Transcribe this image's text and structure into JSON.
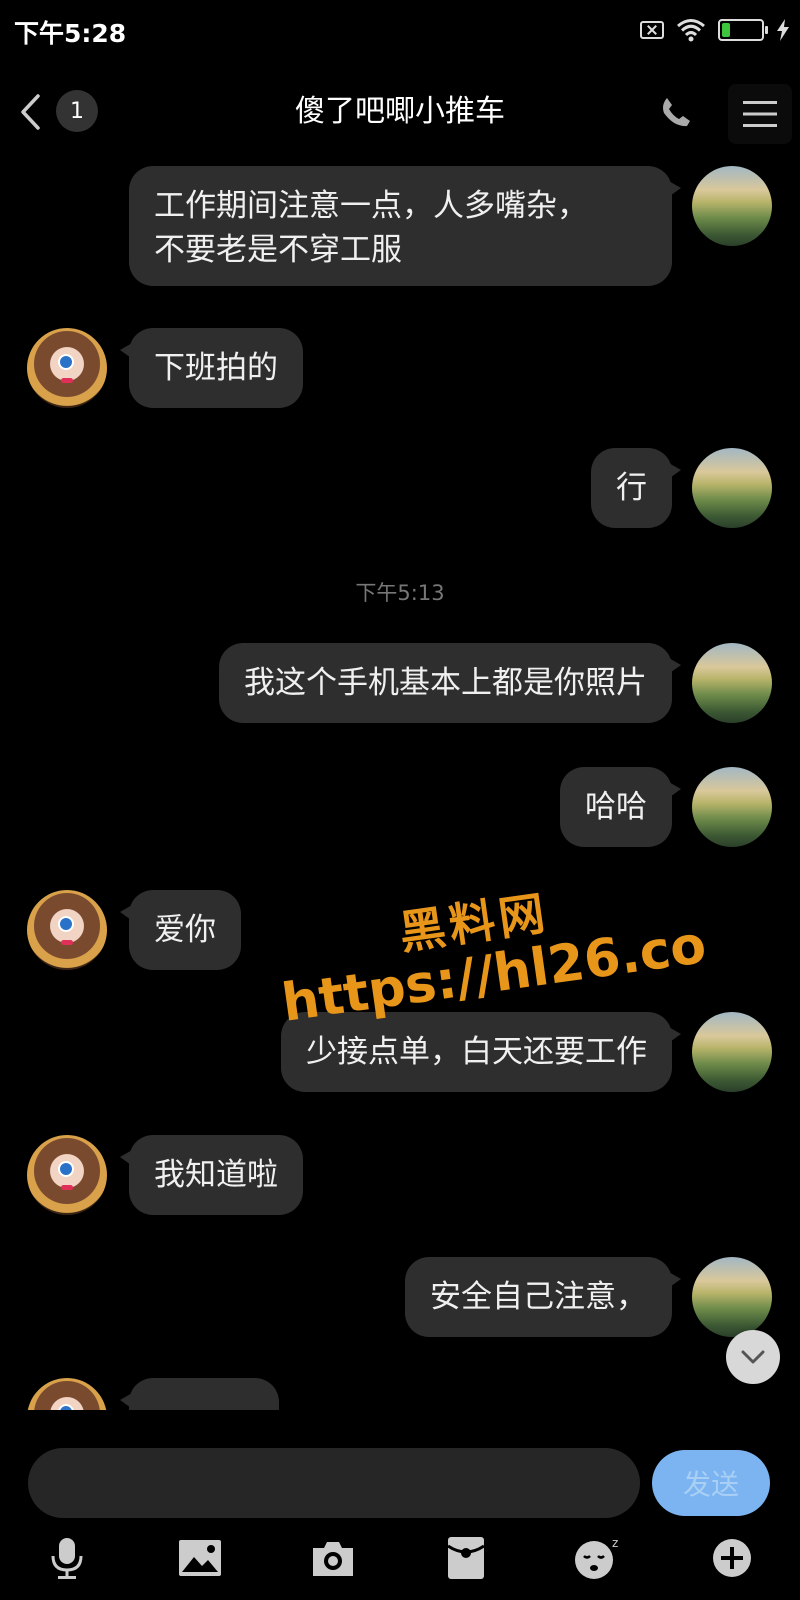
{
  "status_bar": {
    "time": "下午5:28",
    "battery_level": "21",
    "battery_percent": 0.21,
    "icons": [
      "sim-off-icon",
      "wifi-icon",
      "battery-icon",
      "charging-bolt-icon"
    ]
  },
  "header": {
    "title": "傻了吧唧小推车",
    "unread_count": "1",
    "back_icon": "chevron-left-icon",
    "call_icon": "phone-icon",
    "menu_icon": "menu-icon"
  },
  "messages": [
    {
      "side": "right",
      "lines": [
        "工作期间注意一点，人多嘴杂，",
        "不要老是不穿工服"
      ]
    },
    {
      "side": "left",
      "text": "下班拍的"
    },
    {
      "side": "right",
      "text": "行"
    },
    {
      "side": "right",
      "text": "我这个手机基本上都是你照片"
    },
    {
      "side": "right",
      "text": "哈哈"
    },
    {
      "side": "left",
      "text": "爱你"
    },
    {
      "side": "right",
      "text": "少接点单，白天还要工作"
    },
    {
      "side": "left",
      "text": "我知道啦"
    },
    {
      "side": "right",
      "text": "安全自己注意，"
    }
  ],
  "timestamp": "下午5:13",
  "watermark": {
    "line1": "黑料网",
    "line2": "https://hl26.co"
  },
  "input": {
    "placeholder": "",
    "send_label": "发送"
  },
  "toolbar": [
    "microphone-icon",
    "image-icon",
    "camera-icon",
    "red-packet-icon",
    "emoji-icon",
    "plus-icon"
  ],
  "colors": {
    "background": "#000000",
    "bubble": "#2e2e2e",
    "send_button": "#7bb4f0",
    "watermark": "#e8961a",
    "battery_fill": "#3ec53e"
  }
}
